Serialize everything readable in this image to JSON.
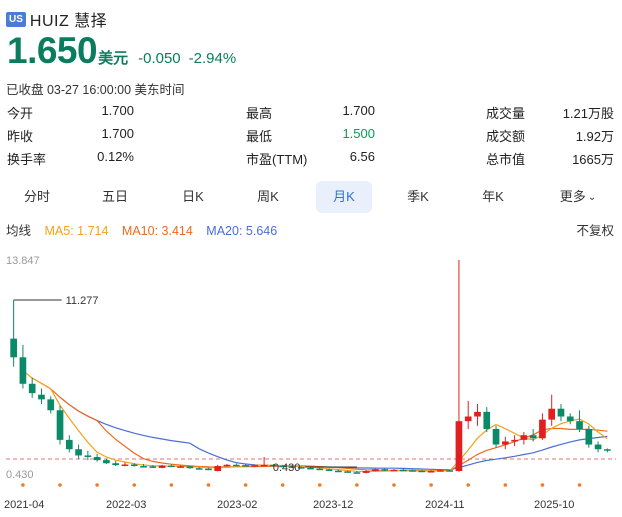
{
  "header": {
    "market": "US",
    "ticker_name": "HUIZ 慧择"
  },
  "quote": {
    "price": "1.650",
    "currency": "美元",
    "change": "-0.050",
    "change_pct": "-2.94%",
    "status": "已收盘 03-27 16:00:00 美东时间"
  },
  "stats": {
    "rows": [
      [
        {
          "label": "今开",
          "value": "1.700"
        },
        {
          "label": "最高",
          "value": "1.700"
        },
        {
          "label": "成交量",
          "value": "1.21万股"
        }
      ],
      [
        {
          "label": "昨收",
          "value": "1.700"
        },
        {
          "label": "最低",
          "value": "1.500"
        },
        {
          "label": "成交额",
          "value": "1.92万"
        }
      ],
      [
        {
          "label": "换手率",
          "value": "0.12%"
        },
        {
          "label": "市盈(TTM)",
          "value": "6.56"
        },
        {
          "label": "总市值",
          "value": "1665万"
        }
      ]
    ]
  },
  "tabs": [
    "分时",
    "五日",
    "日K",
    "周K",
    "月K",
    "季K",
    "年K",
    "更多"
  ],
  "active_tab": "月K",
  "ma": {
    "label": "均线",
    "ma5": "MA5: 1.714",
    "ma10": "MA10: 3.414",
    "ma20": "MA20: 5.646",
    "adjust": "不复权"
  },
  "colors": {
    "up": "#e02020",
    "down": "#0b8a6a",
    "ma5": "#f2a21a",
    "ma10": "#ee6a1f",
    "ma20": "#4a6ed9"
  },
  "chart_data": {
    "type": "candlestick",
    "y_axis_labels": [
      "13.847",
      "0.430"
    ],
    "ylim": [
      0.43,
      13.847
    ],
    "max_marker": "11.277",
    "min_marker": "0.430",
    "x_labels": [
      "2021-04",
      "2022-03",
      "2023-02",
      "2023-12",
      "2024-11",
      "2025-10"
    ],
    "candles": [
      [
        8.8,
        11.277,
        7.0,
        7.6
      ],
      [
        7.6,
        8.4,
        5.6,
        5.9
      ],
      [
        5.9,
        6.3,
        5.0,
        5.3
      ],
      [
        5.2,
        5.6,
        4.6,
        4.9
      ],
      [
        4.9,
        5.1,
        4.0,
        4.2
      ],
      [
        4.2,
        4.5,
        2.0,
        2.3
      ],
      [
        2.3,
        2.6,
        1.5,
        1.7
      ],
      [
        1.7,
        2.0,
        1.1,
        1.3
      ],
      [
        1.3,
        1.6,
        1.0,
        1.2
      ],
      [
        1.2,
        1.4,
        0.9,
        1.0
      ],
      [
        1.0,
        1.1,
        0.75,
        0.8
      ],
      [
        0.8,
        0.95,
        0.62,
        0.68
      ],
      [
        0.68,
        0.85,
        0.6,
        0.72
      ],
      [
        0.72,
        0.8,
        0.58,
        0.62
      ],
      [
        0.62,
        0.75,
        0.55,
        0.6
      ],
      [
        0.6,
        0.68,
        0.5,
        0.55
      ],
      [
        0.5,
        0.7,
        0.48,
        0.65
      ],
      [
        0.65,
        0.72,
        0.55,
        0.58
      ],
      [
        0.58,
        0.66,
        0.52,
        0.6
      ],
      [
        0.6,
        0.62,
        0.45,
        0.48
      ],
      [
        0.48,
        0.55,
        0.4,
        0.45
      ],
      [
        0.45,
        0.52,
        0.38,
        0.42
      ],
      [
        0.3,
        0.7,
        0.28,
        0.62
      ],
      [
        0.62,
        0.75,
        0.6,
        0.7
      ],
      [
        0.7,
        0.78,
        0.62,
        0.68
      ],
      [
        0.68,
        0.75,
        0.6,
        0.65
      ],
      [
        0.65,
        0.72,
        0.6,
        0.68
      ],
      [
        0.68,
        1.2,
        0.6,
        0.7
      ],
      [
        0.7,
        0.75,
        0.6,
        0.64
      ],
      [
        0.64,
        0.7,
        0.58,
        0.6
      ],
      [
        0.6,
        0.66,
        0.5,
        0.55
      ],
      [
        0.55,
        0.6,
        0.48,
        0.5
      ],
      [
        0.5,
        0.55,
        0.42,
        0.45
      ],
      [
        0.45,
        0.5,
        0.38,
        0.4
      ],
      [
        0.4,
        0.45,
        0.3,
        0.32
      ],
      [
        0.32,
        0.38,
        0.25,
        0.28
      ],
      [
        0.28,
        0.32,
        0.2,
        0.22
      ],
      [
        0.22,
        0.3,
        0.15,
        0.18
      ],
      [
        0.18,
        0.35,
        0.15,
        0.3
      ],
      [
        0.3,
        0.45,
        0.28,
        0.42
      ],
      [
        0.42,
        0.48,
        0.3,
        0.35
      ],
      [
        0.35,
        0.42,
        0.3,
        0.38
      ],
      [
        0.38,
        0.45,
        0.3,
        0.35
      ],
      [
        0.35,
        0.4,
        0.28,
        0.32
      ],
      [
        0.32,
        0.36,
        0.25,
        0.28
      ],
      [
        0.28,
        0.34,
        0.22,
        0.3
      ],
      [
        0.3,
        0.4,
        0.28,
        0.35
      ],
      [
        0.35,
        0.38,
        0.28,
        0.3
      ],
      [
        0.3,
        13.847,
        0.25,
        3.5
      ],
      [
        3.5,
        4.8,
        3.0,
        3.8
      ],
      [
        3.8,
        4.6,
        3.2,
        4.1
      ],
      [
        4.1,
        4.4,
        2.8,
        3.0
      ],
      [
        3.0,
        3.2,
        1.8,
        2.0
      ],
      [
        2.0,
        2.5,
        1.7,
        2.2
      ],
      [
        2.2,
        2.6,
        1.9,
        2.3
      ],
      [
        2.3,
        2.8,
        2.0,
        2.6
      ],
      [
        2.6,
        3.0,
        2.2,
        2.4
      ],
      [
        2.4,
        4.0,
        2.3,
        3.6
      ],
      [
        3.6,
        5.2,
        3.2,
        4.3
      ],
      [
        4.3,
        4.6,
        3.5,
        3.8
      ],
      [
        3.8,
        4.0,
        3.3,
        3.5
      ],
      [
        3.5,
        4.2,
        2.8,
        3.0
      ],
      [
        3.0,
        3.2,
        1.8,
        2.0
      ],
      [
        2.0,
        2.2,
        1.5,
        1.7
      ],
      [
        1.7,
        1.75,
        1.5,
        1.65
      ]
    ]
  }
}
